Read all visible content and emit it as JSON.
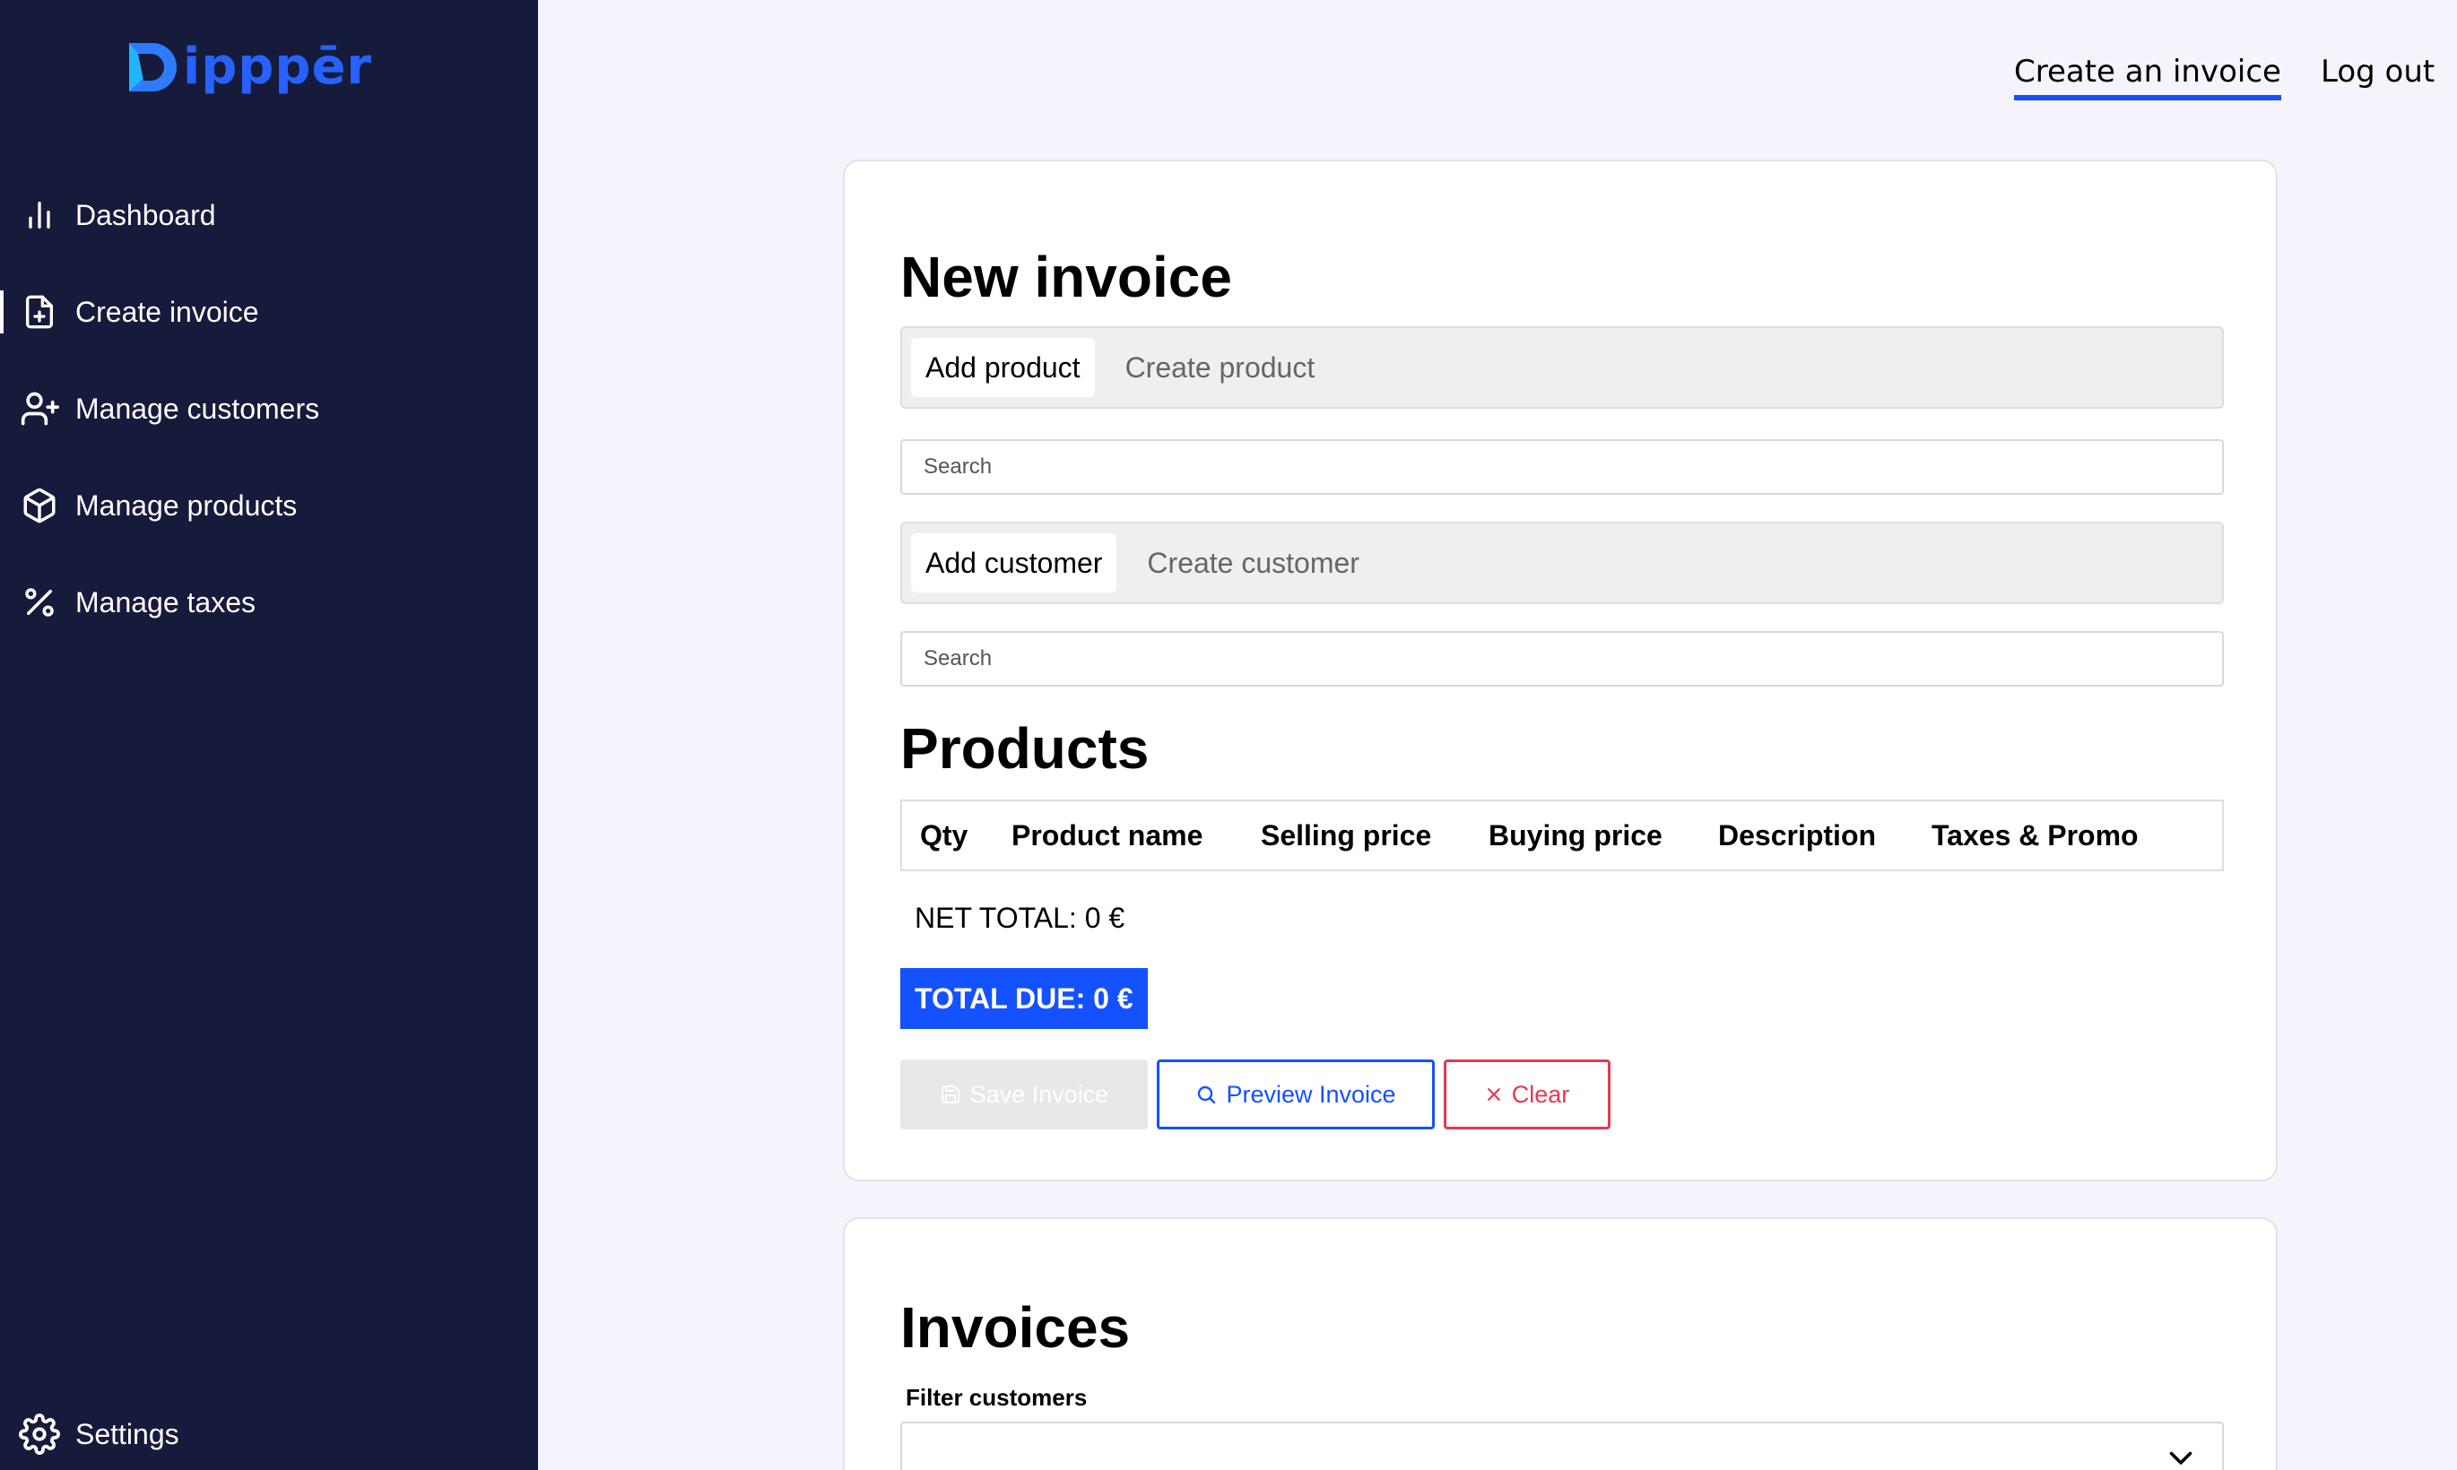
{
  "app": {
    "logo_text": "ipppēr",
    "logo_color": "#2762ff"
  },
  "sidebar": {
    "items": [
      {
        "label": "Dashboard",
        "icon": "bar-chart-icon"
      },
      {
        "label": "Create invoice",
        "icon": "file-plus-icon",
        "active": true
      },
      {
        "label": "Manage customers",
        "icon": "user-plus-icon"
      },
      {
        "label": "Manage products",
        "icon": "box-icon"
      },
      {
        "label": "Manage taxes",
        "icon": "percent-icon"
      }
    ],
    "settings": {
      "label": "Settings",
      "icon": "gear-icon"
    }
  },
  "header": {
    "create_link": "Create an invoice",
    "logout_link": "Log out"
  },
  "new_invoice": {
    "title": "New invoice",
    "product_tabs": [
      "Add product",
      "Create product"
    ],
    "product_search_placeholder": "Search",
    "customer_tabs": [
      "Add customer",
      "Create customer"
    ],
    "customer_search_placeholder": "Search",
    "products_title": "Products",
    "columns": [
      "Qty",
      "Product name",
      "Selling price",
      "Buying price",
      "Description",
      "Taxes & Promo"
    ],
    "net_total": "NET TOTAL: 0 €",
    "total_due": "TOTAL DUE: 0 €",
    "buttons": {
      "save": "Save Invoice",
      "preview": "Preview Invoice",
      "clear": "Clear"
    }
  },
  "invoices": {
    "title": "Invoices",
    "filter_label": "Filter customers",
    "filter_value": ""
  },
  "colors": {
    "sidebar_bg": "#161b3c",
    "accent": "#1451ff",
    "danger": "#e33a4f",
    "page_bg": "#f5f4fd"
  }
}
